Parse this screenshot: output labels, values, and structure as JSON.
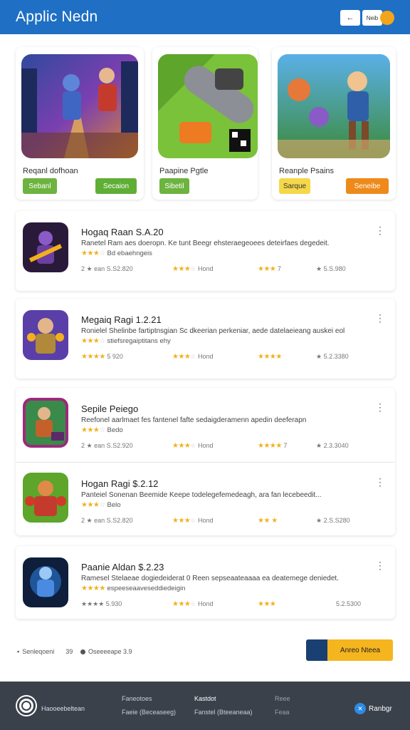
{
  "header": {
    "title": "Applic Nedn",
    "back_label": "←",
    "label_btn": "Neib",
    "coin_label": "●"
  },
  "featured": [
    {
      "title": "Reqanl dofhoan",
      "btn_left": "Sebanl",
      "btn_right": "Secaion",
      "left_color": "#6db33f",
      "right_color": "#5fae35"
    },
    {
      "title": "Paapine Pgtle",
      "btn_left": "Sibetil",
      "btn_right": "",
      "left_color": "#6db33f",
      "right_color": ""
    },
    {
      "title": "Reanple Psains",
      "btn_left": "Sarque",
      "btn_right": "Seneibe",
      "left_color": "#f5d84a",
      "right_color": "#ee8a1a"
    }
  ],
  "list": [
    {
      "title": "Hogaq Raan S.A.20",
      "desc": "Ranetel Ram aes doeropn. Ke tunt Beegr ehsteraegeoees deteirfaes degedeit.",
      "rating_text": "Bd ebaehngeis",
      "meta1": "2 ★ ean S.S2.820",
      "meta2_text": "Hond",
      "meta3_text": "7",
      "meta4": "★ 5.S.980",
      "rating_main": 3,
      "rating_m2": 3,
      "rating_m3": 3
    },
    {
      "title": "Megaiq Ragi 1.2.21",
      "desc": "Ronielel Shelinbe fartiptnsgian Sc dkeerian perkeniar, aede datelaeieang auskei eol",
      "rating_text": "stiefsregaiptitans ehy",
      "meta1": "★★★★ 5 920",
      "meta2_text": "Hond",
      "meta3_text": "",
      "meta4": "★ 5.2.3380",
      "rating_main": 3,
      "rating_m2": 3,
      "rating_m3": 4
    },
    {
      "title": "Sepile Peiego",
      "desc": "Reefonel aarlmaet fes fantenel fafte sedaigderamenn apedin deeferapn",
      "rating_text": "Bedo",
      "meta1": "2 ★ ean S.S2.920",
      "meta2_text": "Hond",
      "meta3_text": "7",
      "meta4": "★ 2.3.3040",
      "rating_main": 3,
      "rating_m2": 3,
      "rating_m3": 4
    },
    {
      "title": "Hogan Ragi $.2.12",
      "desc": "Panteiel Sonenan Beemide Keepe todelegefemedeagh, ara fan lecebeedit...",
      "rating_text": "Belo",
      "meta1": "2 ★ ean S.S2.820",
      "meta2_text": "Hond",
      "meta3_text": "",
      "meta4": "★ 2.S.S280",
      "rating_main": 3,
      "rating_m2": 3,
      "rating_m3": 2
    },
    {
      "title": "Paanie Aldan $.2.23",
      "desc": "Ramesel Stelaeae dogiedeiderat 0 Reen sepseaateaaaa ea deatemege deniedet.",
      "rating_text": "espeeseaaveseddiedeigin",
      "meta1": "★★★★ 5.930",
      "meta2_text": "Hond",
      "meta3_text": "",
      "meta4": "5.2.5300",
      "rating_main": 4,
      "rating_m2": 3,
      "rating_m3": 3
    }
  ],
  "summary": {
    "left_text": "Senleqoeni",
    "left_count": "39",
    "mid_text": "Oseeeeape 3.9",
    "cta_label": "Anreo Nteea"
  },
  "footer": {
    "brand": "Haooeebeltean",
    "col1_a": "Faneotoes",
    "col1_b": "Faeie (Beceaseeg)",
    "col2_a": "Kastdot",
    "col2_b": "Fanstel (Bteeaneaa)",
    "col3_a": "Reee",
    "col3_b": "Feaa",
    "help_label": "Ranbgr",
    "help_icon": "✕"
  }
}
